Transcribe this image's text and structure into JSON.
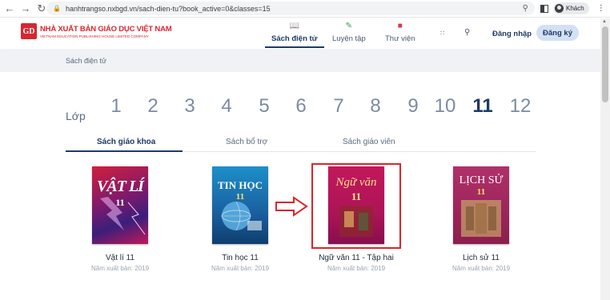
{
  "browser": {
    "url": "hanhtrangso.nxbgd.vn/sach-dien-tu?book_active=0&classes=15",
    "profile": "Khách",
    "back_icon": "arrow-left-icon",
    "forward_icon": "arrow-right-icon",
    "reload_icon": "reload-icon"
  },
  "logo": {
    "badge": "GD",
    "main": "NHÀ XUẤT BẢN GIÁO DỤC VIỆT NAM",
    "sub": "VIETNAM EDUCATION PUBLISHING HOUSE LIMITED COMPANY"
  },
  "nav": {
    "items": [
      {
        "label": "Sách điện tử",
        "icon": "book-open-icon",
        "active": true
      },
      {
        "label": "Luyện tập",
        "icon": "pencil-icon",
        "active": false
      },
      {
        "label": "Thư viện",
        "icon": "library-icon",
        "active": false
      }
    ],
    "login": "Đăng nhập",
    "signup": "Đăng ký"
  },
  "breadcrumb": "Sách điện tử",
  "grade": {
    "label": "Lớp",
    "options": [
      "1",
      "2",
      "3",
      "4",
      "5",
      "6",
      "7",
      "8",
      "9",
      "10",
      "11",
      "12"
    ],
    "selected": "11"
  },
  "tabs": [
    {
      "label": "Sách giáo khoa",
      "active": true
    },
    {
      "label": "Sách bổ trợ",
      "active": false
    },
    {
      "label": "Sách giáo viên",
      "active": false
    }
  ],
  "books": [
    {
      "title": "Vật lí 11",
      "year": "Năm xuất bản: 2019",
      "cover_text": "VẬT LÍ",
      "cover_num": "11"
    },
    {
      "title": "Tin học 11",
      "year": "Năm xuất bản: 2019",
      "cover_text": "TIN HỌC",
      "cover_num": "11"
    },
    {
      "title": "Ngữ văn 11 - Tập hai",
      "year": "Năm xuất bản: 2019",
      "cover_text": "Ngữ văn",
      "cover_num": "11"
    },
    {
      "title": "Lịch sử 11",
      "year": "Năm xuất bản: 2019",
      "cover_text": "LỊCH SỬ",
      "cover_num": "11"
    }
  ],
  "colors": {
    "brand_red": "#d8262e",
    "nav_active": "#1e3a66",
    "highlight": "#d9262b"
  }
}
